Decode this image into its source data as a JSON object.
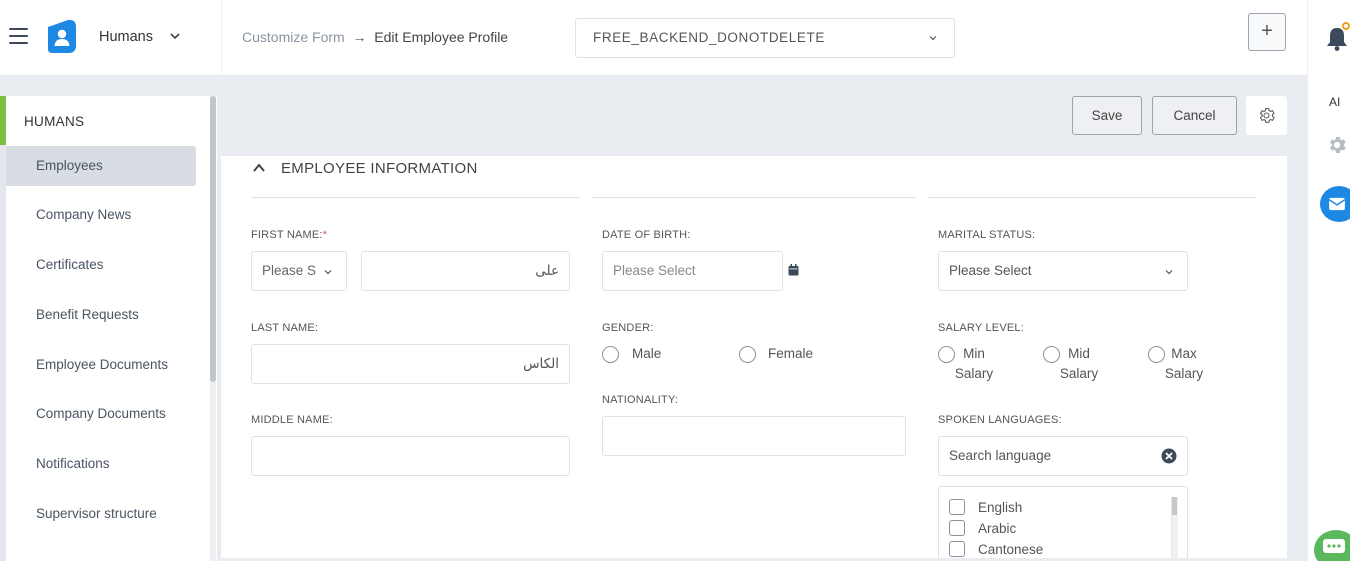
{
  "header": {
    "app_name": "Humans",
    "breadcrumb_parent": "Customize Form",
    "breadcrumb_current": "Edit Employee Profile",
    "company": "FREE_BACKEND_DONOTDELETE",
    "plus_label": "+"
  },
  "rail": {
    "ai_label": "AI"
  },
  "sidebar": {
    "title": "HUMANS",
    "items": [
      {
        "label": "Employees"
      },
      {
        "label": "Company News"
      },
      {
        "label": "Certificates"
      },
      {
        "label": "Benefit Requests"
      },
      {
        "label": "Employee Documents"
      },
      {
        "label": "Company Documents"
      },
      {
        "label": "Notifications"
      },
      {
        "label": "Supervisor structure"
      }
    ]
  },
  "actions": {
    "save": "Save",
    "cancel": "Cancel"
  },
  "form": {
    "section_title": "EMPLOYEE INFORMATION",
    "first_name_label": "FIRST NAME:",
    "required_mark": "*",
    "first_name_prefix": "Please S",
    "first_name_value": "علی",
    "last_name_label": "LAST NAME:",
    "last_name_value": "الکاس",
    "middle_name_label": "MIDDLE NAME:",
    "middle_name_value": "",
    "dob_label": "DATE OF BIRTH:",
    "dob_placeholder": "Please Select",
    "gender_label": "GENDER:",
    "gender_options": [
      "Male",
      "Female"
    ],
    "nationality_label": "NATIONALITY:",
    "nationality_value": "",
    "marital_label": "MARITAL STATUS:",
    "marital_value": "Please Select",
    "salary_label": "SALARY LEVEL:",
    "salary_options": [
      {
        "line1": "Min",
        "line2": "Salary"
      },
      {
        "line1": "Mid",
        "line2": "Salary"
      },
      {
        "line1": "Max",
        "line2": "Salary"
      }
    ],
    "languages_label": "SPOKEN LANGUAGES:",
    "languages_search_placeholder": "Search language",
    "languages": [
      "English",
      "Arabic",
      "Cantonese"
    ]
  },
  "colors": {
    "accent_green": "#7ac143",
    "brand_blue": "#1e88e5",
    "notification_dot": "#f0a020",
    "required_red": "#d9534f"
  }
}
